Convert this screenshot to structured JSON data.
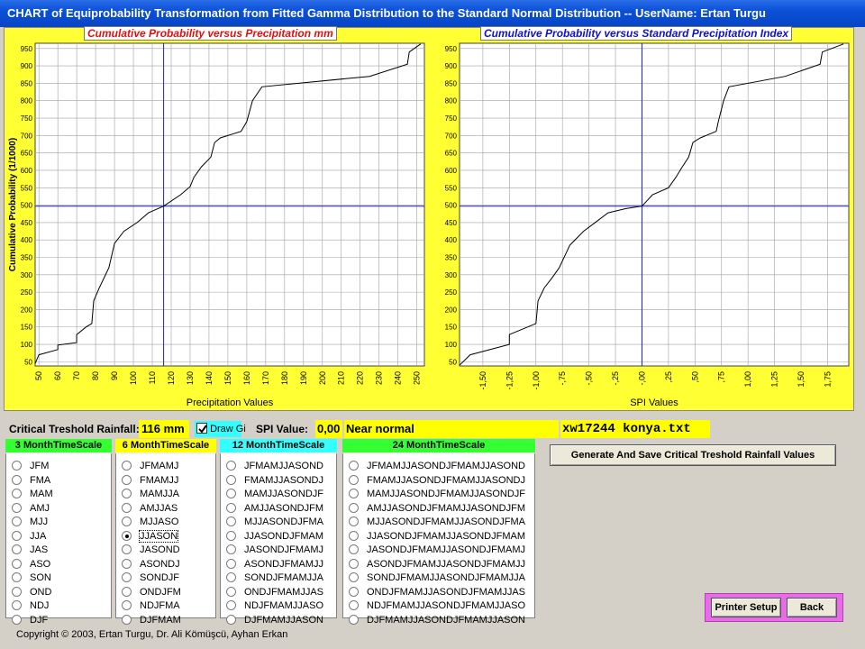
{
  "window": {
    "title": "CHART of Equiprobability Transformation from Fitted Gamma Distribution to the Standard Normal Distribution -- UserName: Ertan Turgu"
  },
  "left_chart": {
    "title": "Cumulative Probability versus Precipitation mm",
    "ylabel": "Cumulative Probability (1/1000)",
    "xlabel": "Precipitation Values",
    "xticks": [
      "50",
      "60",
      "70",
      "80",
      "90",
      "100",
      "110",
      "120",
      "130",
      "140",
      "150",
      "160",
      "170",
      "180",
      "190",
      "200",
      "210",
      "220",
      "230",
      "240",
      "250"
    ],
    "yticks": [
      "50",
      "100",
      "150",
      "200",
      "250",
      "300",
      "350",
      "400",
      "450",
      "500",
      "550",
      "600",
      "650",
      "700",
      "750",
      "800",
      "850",
      "900",
      "950"
    ]
  },
  "right_chart": {
    "title": "Cumulative Probability versus Standard Precipitation Index",
    "xlabel": "SPI Values",
    "xticks": [
      "-1,50",
      "-1,25",
      "-1,00",
      "-,75",
      "-,50",
      "-,25",
      "-,00",
      ",25",
      ",50",
      ",75",
      "1,00",
      "1,25",
      "1,50",
      "1,75"
    ],
    "yticks": [
      "50",
      "100",
      "150",
      "200",
      "250",
      "300",
      "350",
      "400",
      "450",
      "500",
      "550",
      "600",
      "650",
      "700",
      "750",
      "800",
      "850",
      "900",
      "950"
    ]
  },
  "chart_data": [
    {
      "type": "line",
      "title": "Cumulative Probability versus Precipitation mm",
      "xlabel": "Precipitation Values",
      "ylabel": "Cumulative Probability (1/1000)",
      "xlim": [
        48,
        254
      ],
      "ylim": [
        38,
        965
      ],
      "x": [
        48,
        50,
        60,
        60,
        70,
        70,
        75,
        78,
        79,
        82,
        87,
        90,
        95,
        102,
        108,
        113,
        116,
        125,
        130,
        132,
        136,
        141,
        143,
        146,
        157,
        160,
        163,
        168,
        225,
        245,
        246,
        252
      ],
      "y": [
        45,
        70,
        85,
        98,
        105,
        128,
        150,
        160,
        225,
        263,
        320,
        390,
        425,
        450,
        478,
        490,
        497,
        530,
        553,
        580,
        610,
        638,
        680,
        693,
        712,
        740,
        800,
        840,
        870,
        905,
        940,
        963
      ],
      "crosshair": {
        "x": 116,
        "y": 497
      }
    },
    {
      "type": "line",
      "title": "Cumulative Probability versus Standard Precipitation Index",
      "xlabel": "SPI Values",
      "ylabel": "Cumulative Probability (1/1000)",
      "xlim": [
        -1.72,
        1.95
      ],
      "ylim": [
        38,
        965
      ],
      "x": [
        -1.72,
        -1.62,
        -1.25,
        -1.25,
        -1.0,
        -0.98,
        -0.92,
        -0.85,
        -0.78,
        -0.68,
        -0.55,
        -0.45,
        -0.32,
        -0.15,
        0.0,
        0.1,
        0.25,
        0.32,
        0.38,
        0.44,
        0.48,
        0.55,
        0.7,
        0.72,
        0.77,
        0.82,
        1.35,
        1.68,
        1.7,
        1.9
      ],
      "y": [
        40,
        70,
        100,
        128,
        160,
        225,
        263,
        290,
        320,
        385,
        425,
        448,
        478,
        490,
        497,
        530,
        550,
        580,
        610,
        638,
        680,
        693,
        712,
        740,
        800,
        840,
        870,
        905,
        940,
        963
      ],
      "crosshair": {
        "x": 0.0,
        "y": 497
      }
    }
  ],
  "controls": {
    "threshold_label": "Critical Treshold Rainfall:",
    "threshold_value": "116 mm",
    "draw_grid_label": "Draw Gi",
    "spi_label": "SPI Value:",
    "spi_value": "0,00",
    "spi_class": "Near normal",
    "file_name": "xw17244 konya.txt"
  },
  "groups": {
    "g3": {
      "title": "3 MonthTimeScale",
      "color": "#33ff33",
      "options": [
        "JFM",
        "FMA",
        "MAM",
        "AMJ",
        "MJJ",
        "JJA",
        "JAS",
        "ASO",
        "SON",
        "OND",
        "NDJ",
        "DJF"
      ]
    },
    "g6": {
      "title": "6 MonthTimeScale",
      "color": "#ffff00",
      "selected": "JJASON",
      "options": [
        "JFMAMJ",
        "FMAMJJ",
        "MAMJJA",
        "AMJJAS",
        "MJJASO",
        "JJASON",
        "JASOND",
        "ASONDJ",
        "SONDJF",
        "ONDJFM",
        "NDJFMA",
        "DJFMAM"
      ]
    },
    "g12": {
      "title": "12 MonthTimeScale",
      "color": "#33ffff",
      "options": [
        "JFMAMJJASOND",
        "FMAMJJASONDJ",
        "MAMJJASONDJF",
        "AMJJASONDJFM",
        "MJJASONDJFMA",
        "JJASONDJFMAM",
        "JASONDJFMAMJ",
        "ASONDJFMAMJJ",
        "SONDJFMAMJJA",
        "ONDJFMAMJJAS",
        "NDJFMAMJJASO",
        "DJFMAMJJASON"
      ]
    },
    "g24": {
      "title": "24 MonthTimeScale",
      "color": "#33ff33",
      "options": [
        "JFMAMJJASONDJFMAMJJASOND",
        "FMAMJJASONDJFMAMJJASONDJ",
        "MAMJJASONDJFMAMJJASONDJF",
        "AMJJASONDJFMAMJJASONDJFM",
        "MJJASONDJFMAMJJASONDJFMA",
        "JJASONDJFMAMJJASONDJFMAM",
        "JASONDJFMAMJJASONDJFMAMJ",
        "ASONDJFMAMJJASONDJFMAMJJ",
        "SONDJFMAMJJASONDJFMAMJJA",
        "ONDJFMAMJJASONDJFMAMJJAS",
        "NDJFMAMJJASONDJFMAMJJASO",
        "DJFMAMJJASONDJFMAMJJASON"
      ]
    }
  },
  "buttons": {
    "generate": "Generate And Save Critical Treshold Rainfall Values",
    "printer_setup": "Printer Setup",
    "back": "Back"
  },
  "status": {
    "copyright": "Copyright © 2003, Ertan Turgu, Dr. Ali Kömüşcü, Ayhan Erkan"
  }
}
